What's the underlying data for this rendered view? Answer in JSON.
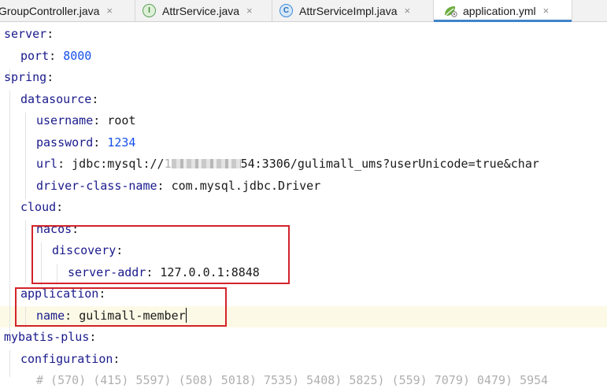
{
  "tabs": [
    {
      "label": "GroupController.java",
      "icon": "none",
      "active": false
    },
    {
      "label": "AttrService.java",
      "icon": "interface-icon",
      "icon_letter": "I",
      "icon_color": "#5aa15a",
      "active": false
    },
    {
      "label": "AttrServiceImpl.java",
      "icon": "class-icon",
      "icon_letter": "C",
      "icon_color": "#3b8ad9",
      "active": false
    },
    {
      "label": "application.yml",
      "icon": "spring-leaf-icon",
      "icon_color": "#6cad3f",
      "active": true
    }
  ],
  "close_glyph": "×",
  "colors": {
    "key": "#1a1a8c",
    "number": "#1750eb",
    "highlight_box": "#d3242a",
    "active_tab_accent": "#4083c9"
  },
  "code": {
    "server_key": "server",
    "port_key": "port",
    "port_value": "8000",
    "spring_key": "spring",
    "datasource_key": "datasource",
    "username_key": "username",
    "username_value": "root",
    "password_key": "password",
    "password_value": "1234",
    "url_key": "url",
    "url_prefix": "jdbc:mysql://",
    "url_blur_mid": "1",
    "url_tail": "54:3306/gulimall_ums?userUnicode=true&char",
    "driver_key": "driver-class-name",
    "driver_value": "com.mysql.jdbc.Driver",
    "cloud_key": "cloud",
    "nacos_key": "nacos",
    "discovery_key": "discovery",
    "server_addr_key": "server-addr",
    "server_addr_value": "127.0.0.1:8848",
    "application_key": "application",
    "name_key": "name",
    "name_value": "gulimall-member",
    "mybatis_key": "mybatis-plus",
    "configuration_key": "configuration",
    "partial_line": "#  (570) (415) 5597) (508) 5018) 7535) 5408) 5825) (559) 7079) 0479) 5954"
  }
}
